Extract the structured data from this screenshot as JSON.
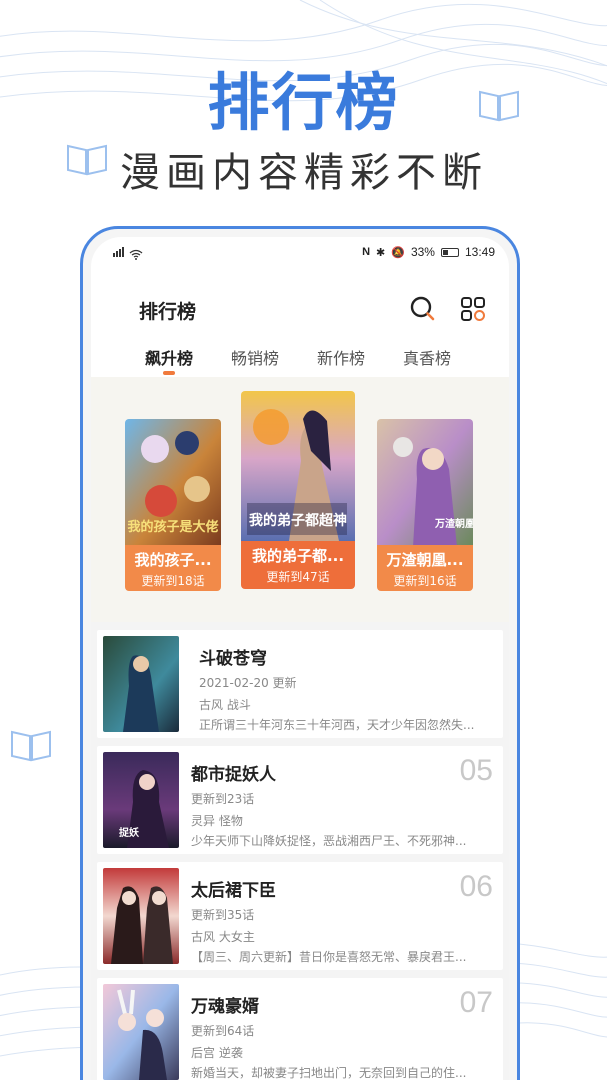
{
  "promo": {
    "title": "排行榜",
    "subtitle": "漫画内容精彩不断"
  },
  "statusbar": {
    "left_icons": [
      "signal-icon",
      "wifi-icon"
    ],
    "battery_pct": "33%",
    "time": "13:49",
    "right_icons": [
      "nfc-icon",
      "bluetooth-icon",
      "mute-icon",
      "battery-icon"
    ]
  },
  "appbar": {
    "title": "排行榜",
    "icons": [
      "search-icon",
      "grid-icon"
    ]
  },
  "tabs": [
    {
      "label": "飙升榜",
      "active": true
    },
    {
      "label": "畅销榜",
      "active": false
    },
    {
      "label": "新作榜",
      "active": false
    },
    {
      "label": "真香榜",
      "active": false
    }
  ],
  "podium": [
    {
      "title": "我的孩子...",
      "update": "更新到18话",
      "cover_text": "我的孩子是大佬"
    },
    {
      "title": "我的弟子都...",
      "update": "更新到47话",
      "cover_text": "我的弟子都超神"
    },
    {
      "title": "万渣朝凰...",
      "update": "更新到16话",
      "cover_text": "万渣朝凰"
    }
  ],
  "list": [
    {
      "title": "斗破苍穹",
      "update": "2021-02-20 更新",
      "tags": "古风 战斗",
      "desc": "正所谓三十年河东三十年河西，天才少年因忽然失...",
      "rank": ""
    },
    {
      "title": "都市捉妖人",
      "update": "更新到23话",
      "tags": "灵异 怪物",
      "desc": "少年天师下山降妖捉怪，恶战湘西尸王、不死邪神...",
      "rank": "05"
    },
    {
      "title": "太后裙下臣",
      "update": "更新到35话",
      "tags": "古风 大女主",
      "desc": "【周三、周六更新】昔日你是喜怒无常、暴戾君王...",
      "rank": "06"
    },
    {
      "title": "万魂豪婿",
      "update": "更新到64话",
      "tags": "后宫 逆袭",
      "desc": "新婚当天，却被妻子扫地出门，无奈回到自己的住...",
      "rank": "07"
    }
  ],
  "colors": {
    "brand_blue": "#3a7bdc",
    "accent_orange": "#f07a3c",
    "card_orange": "#f28a49"
  }
}
